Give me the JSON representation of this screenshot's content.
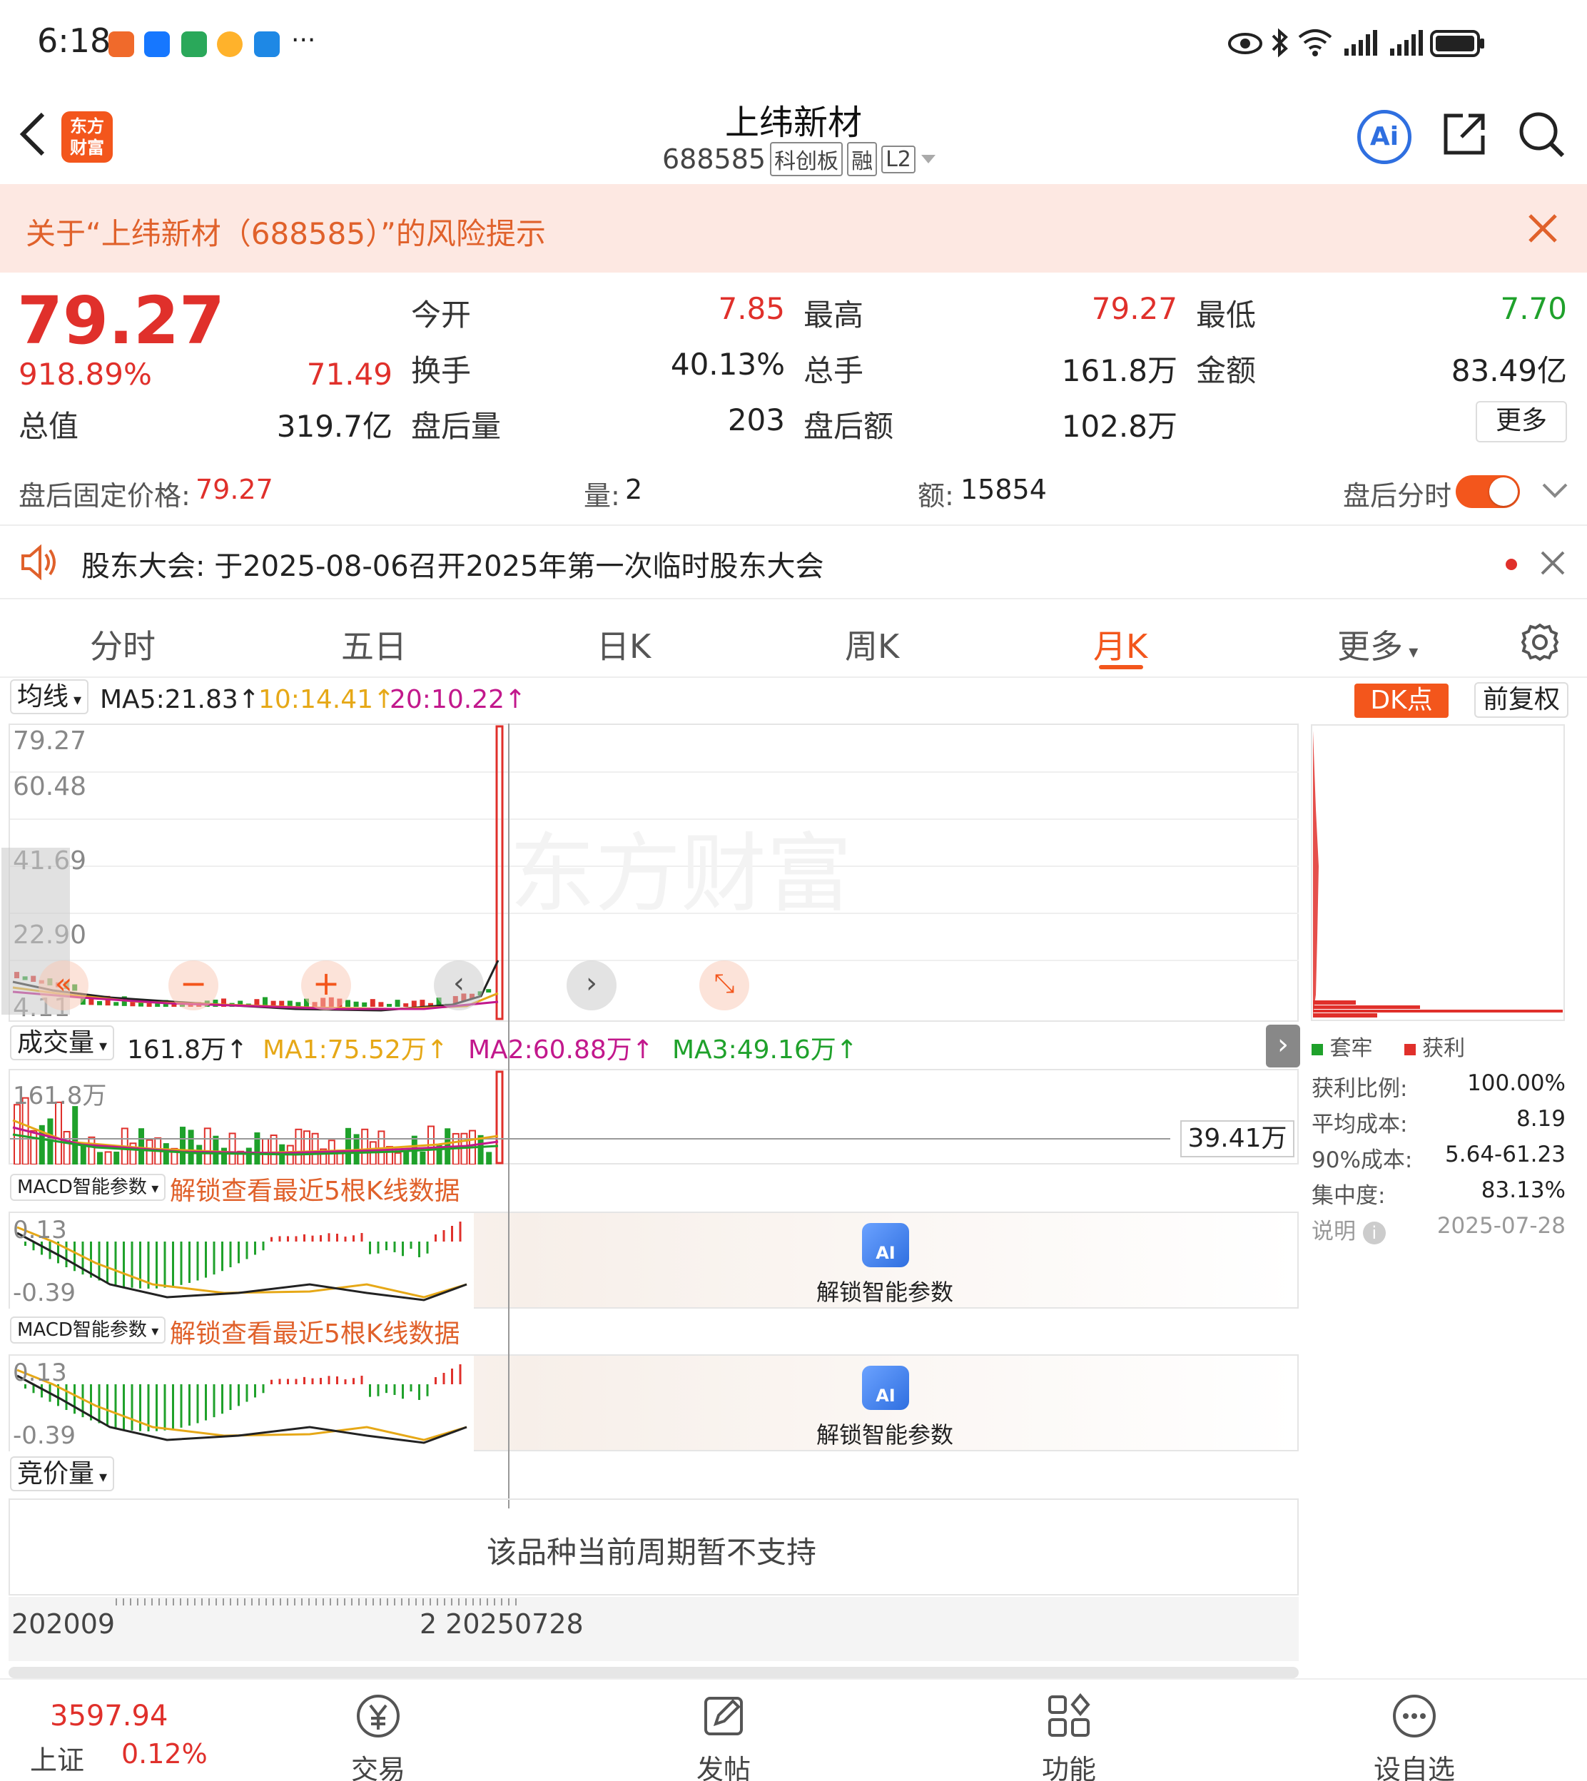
{
  "status_bar": {
    "time": "6:18",
    "more": "···",
    "icons": [
      "eye-icon",
      "bluetooth-icon",
      "wifi-icon",
      "signal-icon",
      "signal-icon",
      "battery-icon"
    ]
  },
  "header": {
    "logo_text": "东方\n财富",
    "title": "上纬新材",
    "code": "688585",
    "badges": [
      "科创板",
      "融",
      "L2"
    ],
    "ai_label": "Ai"
  },
  "risk": {
    "text": "关于“上纬新材（688585）”的风险提示"
  },
  "quote": {
    "price": "79.27",
    "change_pct": "918.89%",
    "change": "71.49",
    "total_value_label": "总值",
    "total_value": "319.7亿",
    "open_label": "今开",
    "open": "7.85",
    "high_label": "最高",
    "high": "79.27",
    "low_label": "最低",
    "low": "7.70",
    "turnover_label": "换手",
    "turnover": "40.13%",
    "volume_label": "总手",
    "volume": "161.8万",
    "amount_label": "金额",
    "amount": "83.49亿",
    "ah_vol_label": "盘后量",
    "ah_vol": "203",
    "ah_amt_label": "盘后额",
    "ah_amt": "102.8万",
    "more": "更多"
  },
  "afterhours": {
    "fixed_price_label": "盘后固定价格:",
    "fixed_price": "79.27",
    "qty_label": "量:",
    "qty": "2",
    "amt_label": "额:",
    "amt": "15854",
    "toggle_label": "盘后分时"
  },
  "notice": {
    "text": "股东大会:  于2025-08-06召开2025年第一次临时股东大会"
  },
  "tabs": [
    {
      "label": "分时"
    },
    {
      "label": "五日"
    },
    {
      "label": "日K"
    },
    {
      "label": "周K"
    },
    {
      "label": "月K"
    },
    {
      "label": "更多"
    }
  ],
  "kline": {
    "indicator_select": "均线",
    "ma5": "MA5:21.83↑",
    "ma10": "10:14.41↑",
    "ma20": "20:10.22↑",
    "dk_label": "DK点",
    "adj_label": "前复权",
    "y_ticks": [
      "79.27",
      "60.48",
      "41.69",
      "22.90",
      "4.11"
    ],
    "watermark": "东方财富",
    "colors": {
      "ma5": "#222222",
      "ma10": "#e6a817",
      "ma20": "#c2188c",
      "up": "#e0302b",
      "down": "#1fa12b"
    }
  },
  "volume": {
    "select": "成交量",
    "value": "161.8万↑",
    "ma1": "MA1:75.52万↑",
    "ma2": "MA2:60.88万↑",
    "ma3": "MA3:49.16万↑",
    "top_tick": "161.8万",
    "crosshair_value": "39.41万"
  },
  "macd": {
    "select": "MACD智能参数",
    "unlock_text": "解锁查看最近5根K线数据",
    "top_tick": "0.13",
    "bottom_tick": "-0.39",
    "ai_badge": "AI",
    "unlock_params": "解锁智能参数"
  },
  "auction": {
    "select": "竞价量",
    "message": "该品种当前周期暂不支持"
  },
  "x_axis": {
    "start": "202009",
    "end": "2 20250728"
  },
  "chip": {
    "legend_trapped": "套牢",
    "legend_profit": "获利",
    "rows": [
      {
        "label": "获利比例:",
        "value": "100.00%"
      },
      {
        "label": "平均成本:",
        "value": "8.19"
      },
      {
        "label": "90%成本:",
        "value": "5.64-61.23"
      },
      {
        "label": "集中度:",
        "value": "83.13%"
      }
    ],
    "note_label": "说明",
    "date": "2025-07-28"
  },
  "bottom": {
    "index_value": "3597.94",
    "index_name": "上证",
    "index_change": "0.12%",
    "nav": [
      {
        "label": "交易",
        "icon": "yen-icon"
      },
      {
        "label": "发帖",
        "icon": "edit-icon"
      },
      {
        "label": "功能",
        "icon": "apps-icon"
      },
      {
        "label": "设自选",
        "icon": "more-icon"
      }
    ]
  }
}
